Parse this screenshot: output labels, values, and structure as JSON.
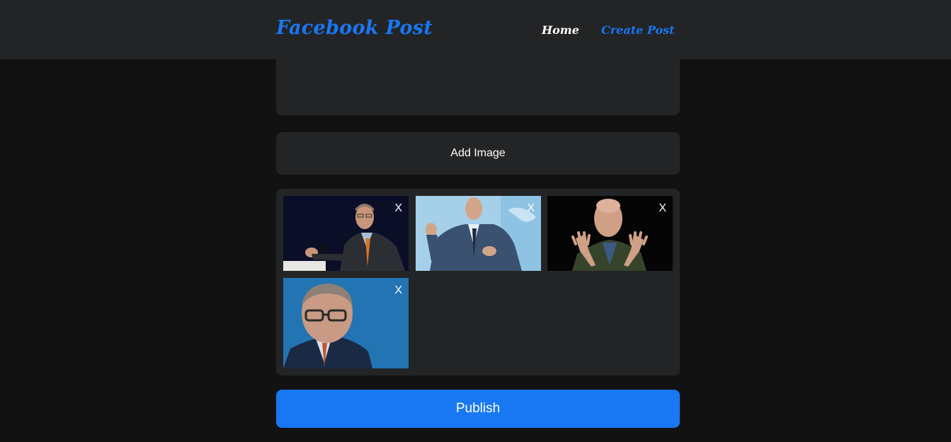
{
  "navbar": {
    "brand": "Facebook Post",
    "links": [
      {
        "label": "Home"
      },
      {
        "label": "Create Post"
      }
    ]
  },
  "composer": {
    "text_value": ""
  },
  "add_image": {
    "label": "Add Image"
  },
  "gallery": {
    "images": [
      {
        "remove_label": "X",
        "subject": "man in suit speaking at podium, dark background"
      },
      {
        "remove_label": "X",
        "subject": "bald man in blue suit gesturing, light blue background"
      },
      {
        "remove_label": "X",
        "subject": "bald man raising both hands, dark background"
      },
      {
        "remove_label": "X",
        "subject": "man with glasses portrait, blue background"
      }
    ]
  },
  "publish": {
    "label": "Publish"
  },
  "colors": {
    "accent": "#1877f2",
    "navbar_bg": "#232426",
    "page_bg": "#121212",
    "card_bg": "#232426"
  }
}
